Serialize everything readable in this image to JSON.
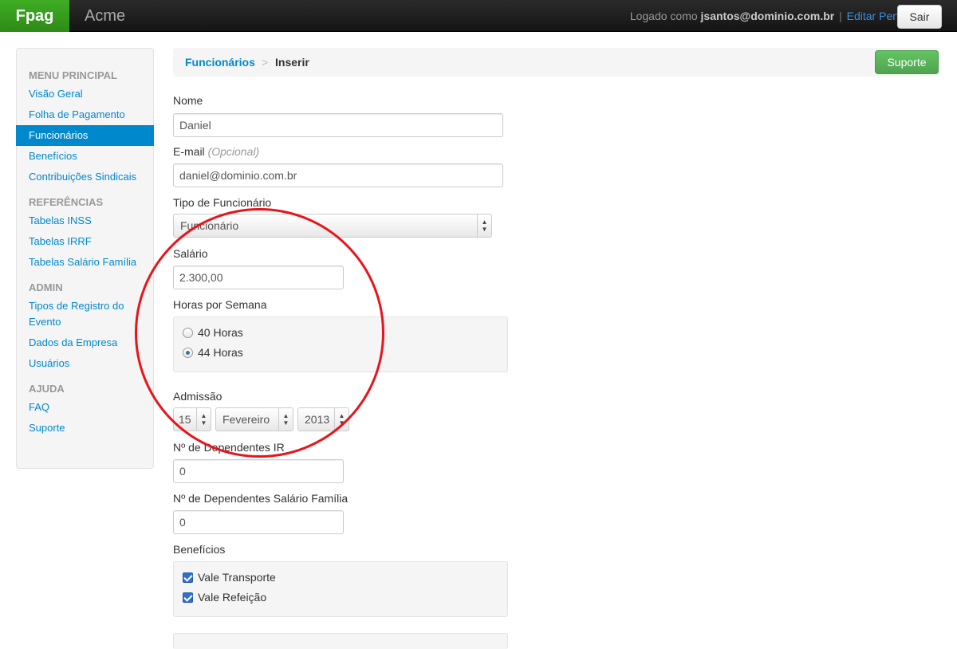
{
  "navbar": {
    "brand": "Fpag",
    "company": "Acme",
    "logged_as_prefix": "Logado como",
    "user": "jsantos@dominio.com.br",
    "separator": "|",
    "edit_profile": "Editar Perfil",
    "logout": "Sair"
  },
  "sidebar": {
    "sections": [
      {
        "header": "MENU PRINCIPAL",
        "items": [
          "Visão Geral",
          "Folha de Pagamento",
          "Funcionários",
          "Benefícios",
          "Contribuições Sindicais"
        ]
      },
      {
        "header": "REFERÊNCIAS",
        "items": [
          "Tabelas INSS",
          "Tabelas IRRF",
          "Tabelas Salário Família"
        ]
      },
      {
        "header": "ADMIN",
        "items": [
          "Tipos de Registro do Evento",
          "Dados da Empresa",
          "Usuários"
        ]
      },
      {
        "header": "AJUDA",
        "items": [
          "FAQ",
          "Suporte"
        ]
      }
    ],
    "active_item": "Funcionários"
  },
  "breadcrumb": {
    "parent": "Funcionários",
    "separator": ">",
    "current": "Inserir"
  },
  "support_button": "Suporte",
  "form": {
    "name_label": "Nome",
    "name_value": "Daniel",
    "email_label": "E-mail",
    "email_optional": "(Opcional)",
    "email_value": "daniel@dominio.com.br",
    "type_label": "Tipo de Funcionário",
    "type_value": "Funcionário",
    "salary_label": "Salário",
    "salary_value": "2.300,00",
    "hours_label": "Horas por Semana",
    "hours_options": [
      "40 Horas",
      "44 Horas"
    ],
    "hours_selected": "44 Horas",
    "admission_label": "Admissão",
    "admission_day": "15",
    "admission_month": "Fevereiro",
    "admission_year": "2013",
    "dep_ir_label": "Nº de Dependentes IR",
    "dep_ir_value": "0",
    "dep_sf_label": "Nº de Dependentes Salário Família",
    "dep_sf_value": "0",
    "benefits_label": "Benefícios",
    "benefits_options": [
      "Vale Transporte",
      "Vale Refeição"
    ],
    "benefits_checked": [
      "Vale Transporte",
      "Vale Refeição"
    ]
  },
  "colors": {
    "brand_green": "#3fae24",
    "link_blue": "#0088cc",
    "annotation_red": "#e8141a",
    "success_green": "#51a351"
  },
  "icons": [
    "radio-icon",
    "checkbox-checked-icon",
    "select-arrows-icon"
  ]
}
